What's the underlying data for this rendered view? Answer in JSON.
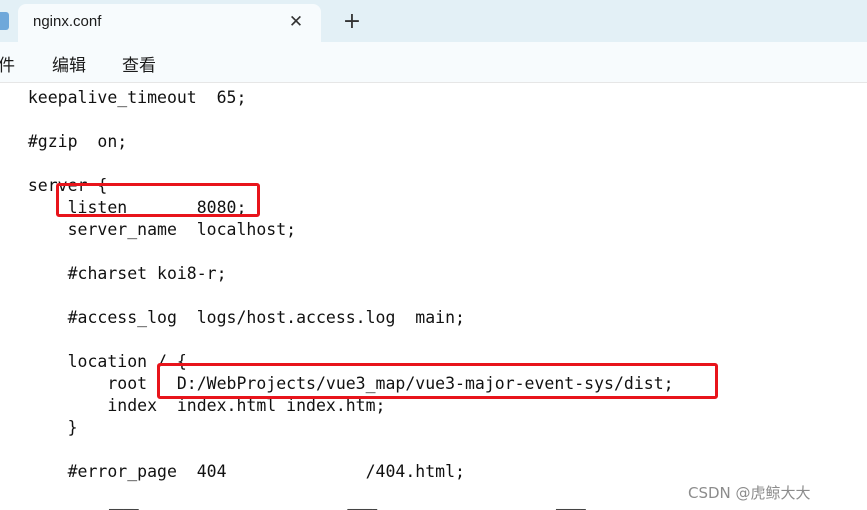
{
  "tab": {
    "title": "nginx.conf",
    "close_glyph": "✕",
    "new_tab_glyph": "+"
  },
  "menu": {
    "items": [
      "件",
      "编辑",
      "查看"
    ]
  },
  "editor": {
    "lines": [
      "  keepalive_timeout  65;",
      "",
      "  #gzip  on;",
      "",
      "  server {",
      "      listen       8080;",
      "      server_name  localhost;",
      "",
      "      #charset koi8-r;",
      "",
      "      #access_log  logs/host.access.log  main;",
      "",
      "      location / {",
      "          root   D:/WebProjects/vue3_map/vue3-major-event-sys/dist;",
      "          index  index.html index.htm;",
      "      }",
      "",
      "      #error_page  404              /404.html;"
    ],
    "highlight_color": "#e8141b"
  },
  "watermark": "CSDN @虎鲸大大"
}
